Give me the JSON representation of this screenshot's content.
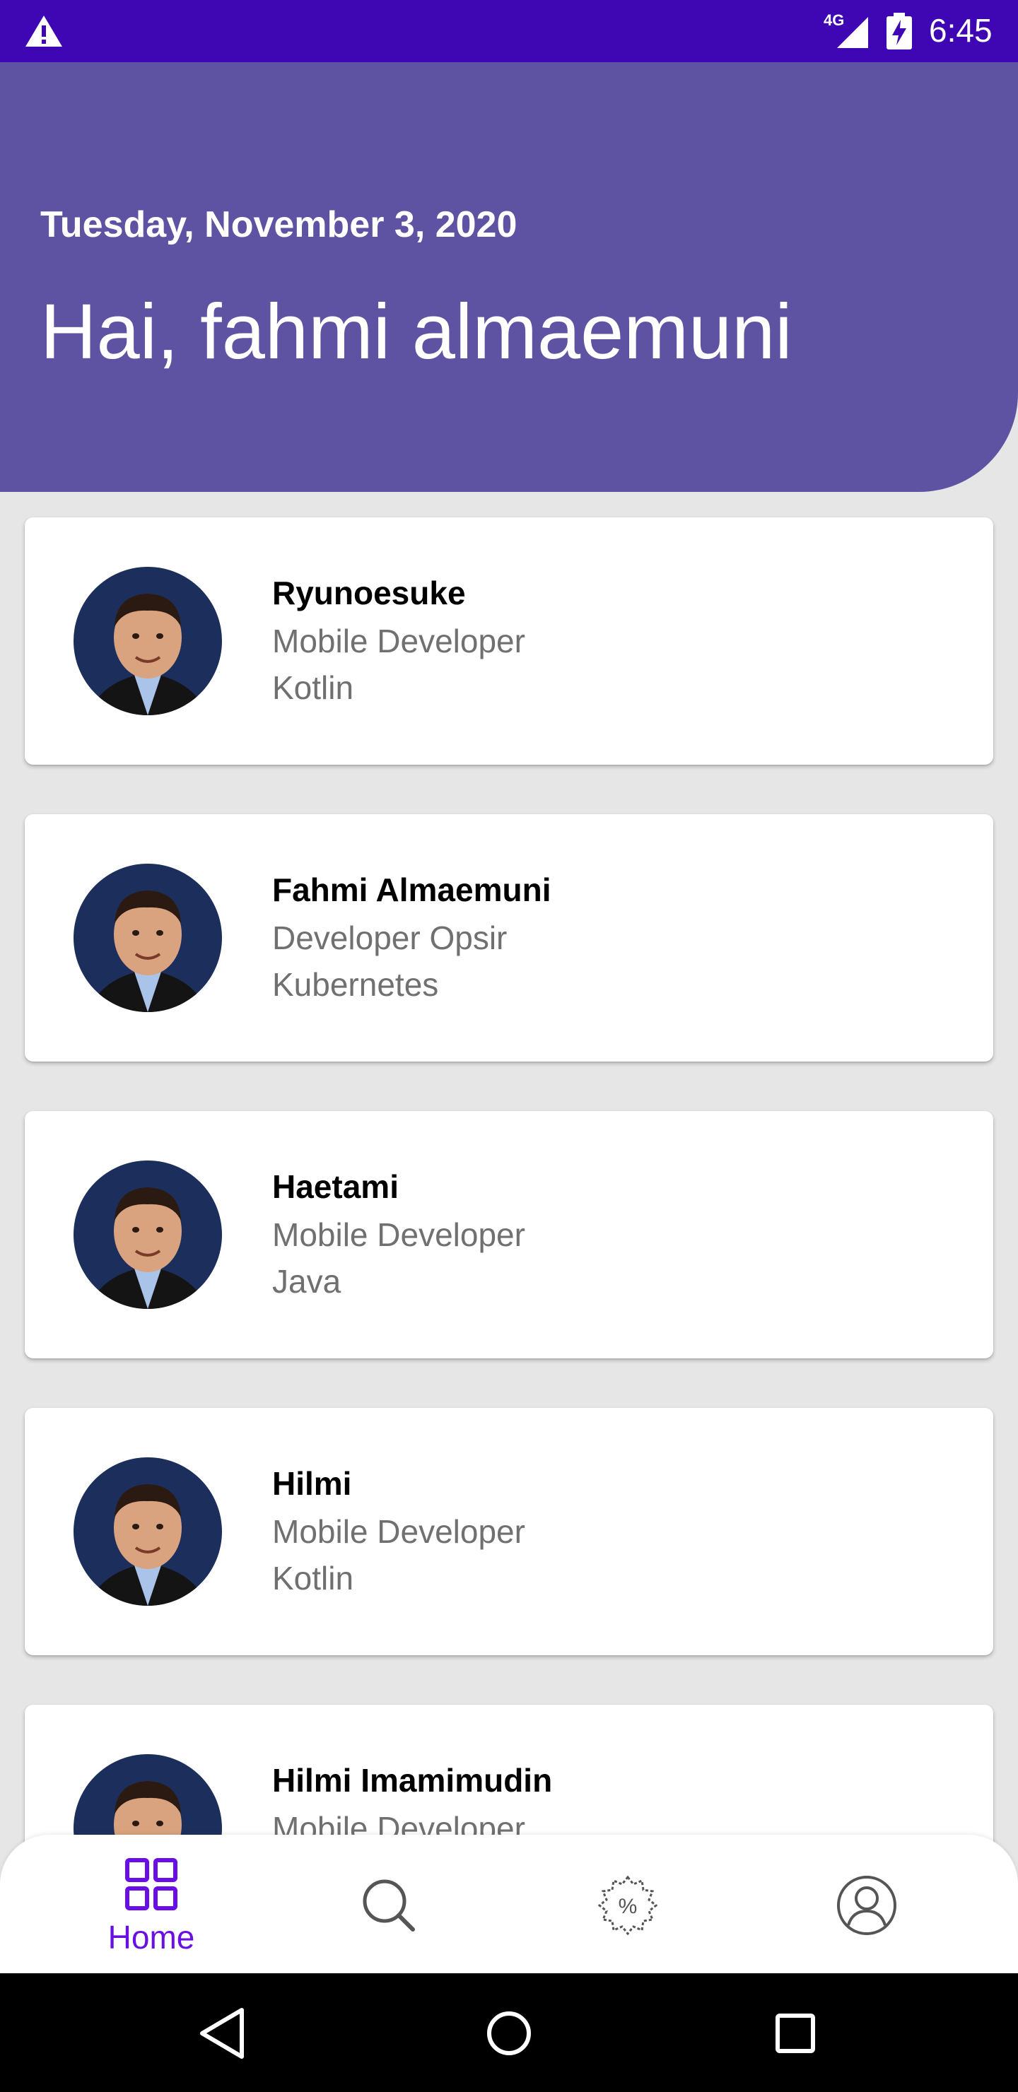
{
  "status_bar": {
    "network": "4G",
    "time": "6:45",
    "bg_color": "#3f06b3"
  },
  "header": {
    "date": "Tuesday, November 3, 2020",
    "greeting": "Hai, fahmi almaemuni",
    "bg_color": "#5e52a2"
  },
  "people": [
    {
      "name": "Ryunoesuke",
      "role": "Mobile Developer",
      "tech": "Kotlin"
    },
    {
      "name": "Fahmi Almaemuni",
      "role": "Developer Opsir",
      "tech": "Kubernetes"
    },
    {
      "name": "Haetami",
      "role": "Mobile Developer",
      "tech": "Java"
    },
    {
      "name": "Hilmi",
      "role": "Mobile Developer",
      "tech": "Kotlin"
    },
    {
      "name": "Hilmi Imamimudin",
      "role": "Mobile Developer",
      "tech": ""
    }
  ],
  "bottom_nav": {
    "items": [
      {
        "label": "Home",
        "icon": "grid-icon",
        "active": true
      },
      {
        "label": "",
        "icon": "search-icon",
        "active": false
      },
      {
        "label": "",
        "icon": "discount-badge-icon",
        "active": false
      },
      {
        "label": "",
        "icon": "profile-icon",
        "active": false
      }
    ],
    "active_color": "#6a0ee6"
  },
  "system_nav": {
    "icons": [
      "back-icon",
      "home-circle-icon",
      "recents-icon"
    ]
  }
}
